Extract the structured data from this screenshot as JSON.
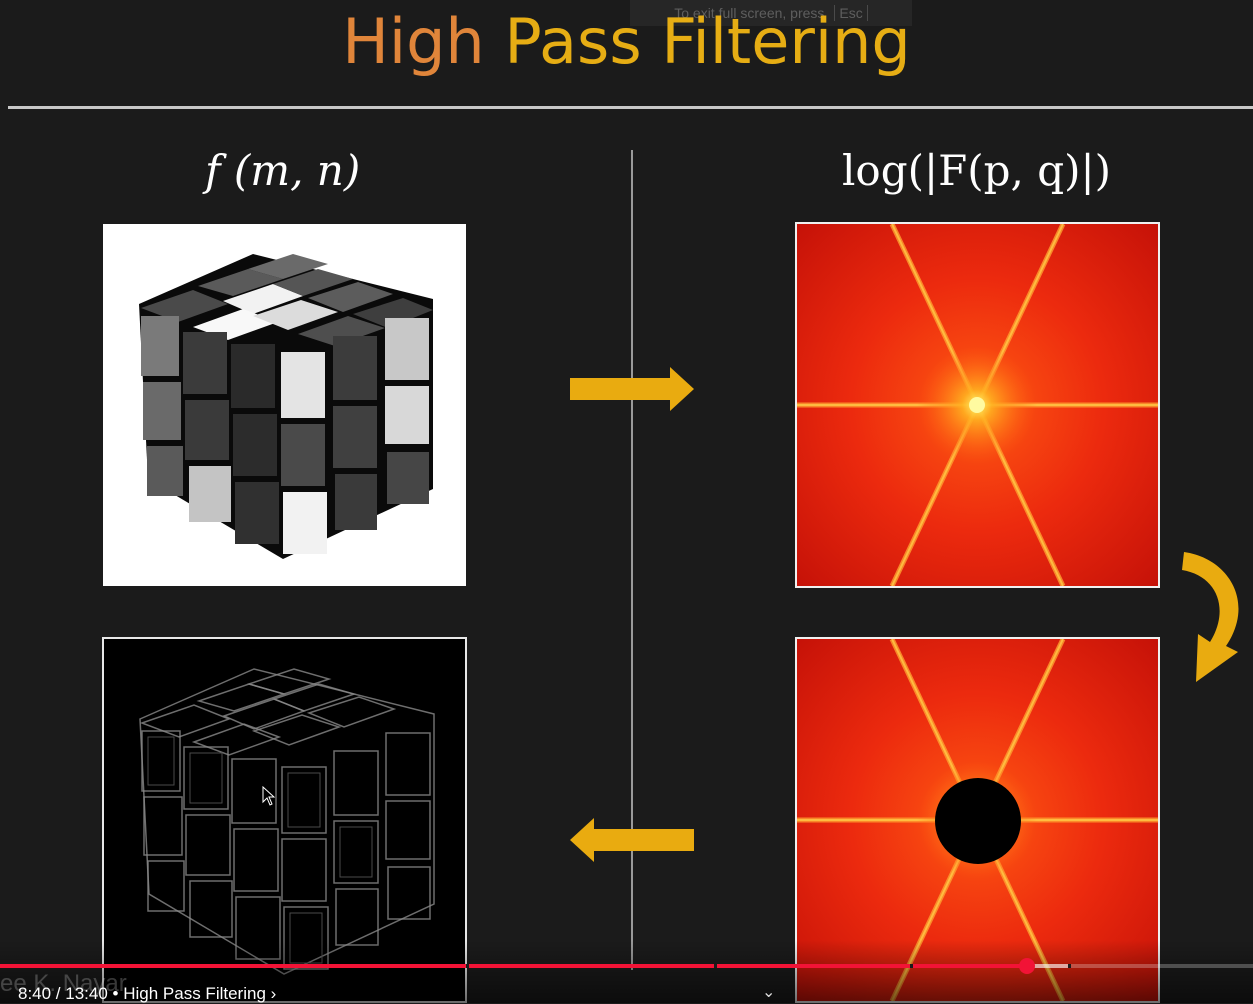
{
  "fullscreen_hint": {
    "text": "To exit full screen, press",
    "key": "Esc"
  },
  "slide": {
    "title_first": "High",
    "title_rest": " Pass Filtering",
    "label_left": "f (m, n)",
    "label_right": "log(|F(p, q)|)",
    "colors": {
      "title_orange": "#e0853a",
      "title_yellow": "#e6ad14",
      "arrow": "#e9ab10"
    },
    "icons": [
      "arrow-right-icon",
      "curved-arrow-down-icon",
      "arrow-left-icon"
    ]
  },
  "player": {
    "time": "8:40 / 13:40",
    "separator": "•",
    "chapter": "High Pass Filtering",
    "chapter_chevron": "›",
    "expand_chevron": "⌄",
    "watermark": "ee K. Nayar",
    "progress_played": 0.82,
    "progress_buffered": 0.853,
    "colors": {
      "played": "#f21336"
    }
  }
}
